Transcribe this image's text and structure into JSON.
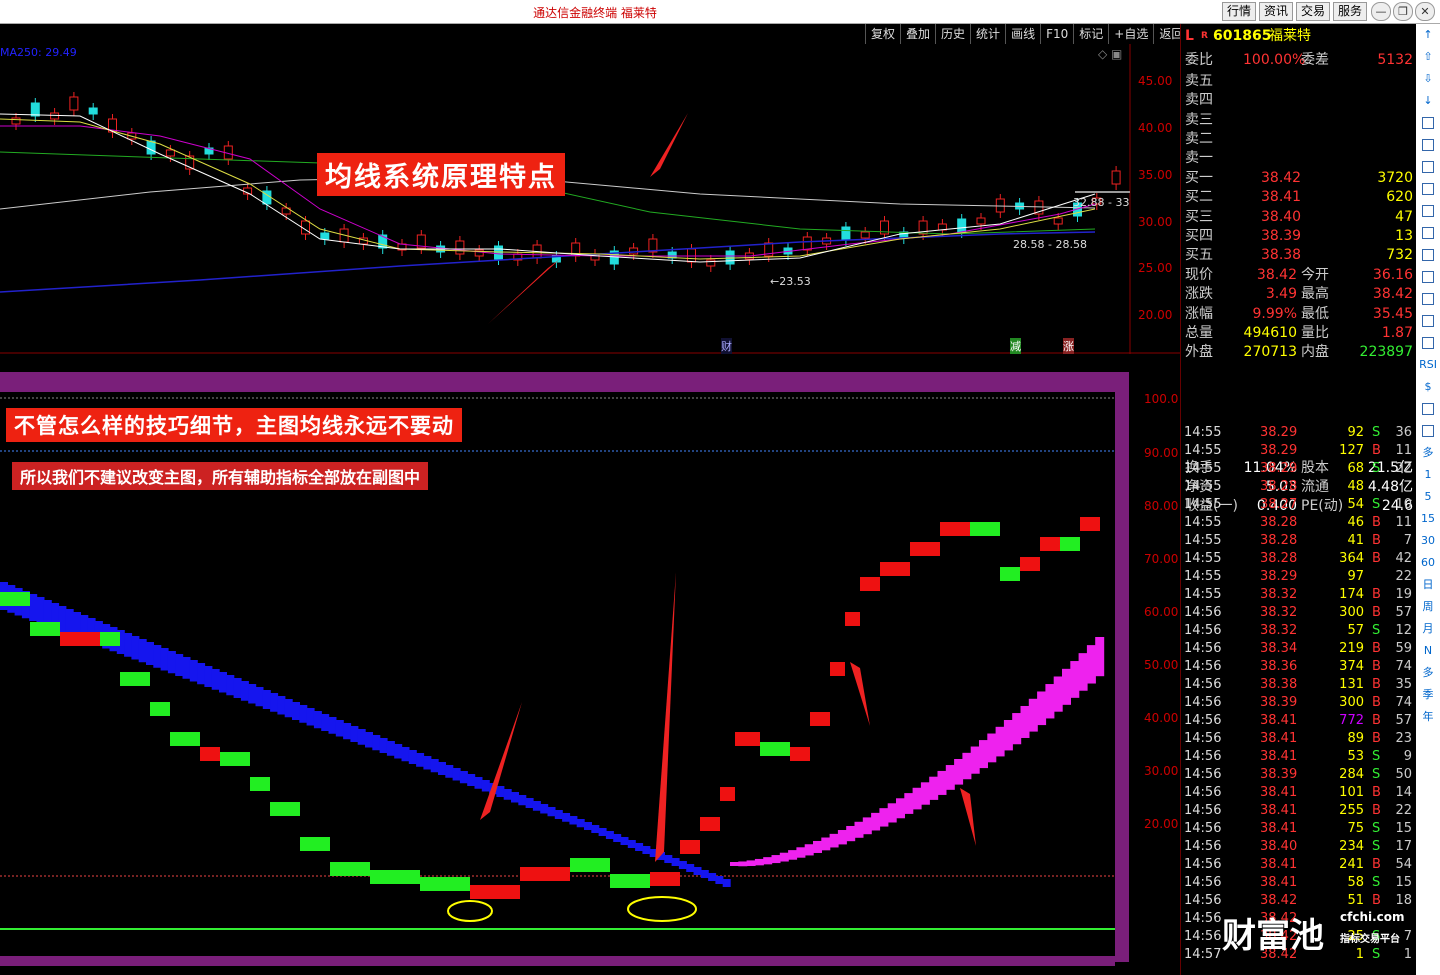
{
  "window": {
    "title": "通达信金融终端  福莱特",
    "buttons": [
      "行情",
      "资讯",
      "交易",
      "服务"
    ]
  },
  "toolbar": [
    "复权",
    "叠加",
    "历史",
    "统计",
    "画线",
    "F10",
    "标记",
    "+自选",
    "返回"
  ],
  "main": {
    "ma_label": "MA250: 29.49",
    "title_banner": "均线系统原理特点",
    "ticks": [
      "45.00",
      "40.00",
      "35.00",
      "30.00",
      "25.00",
      "20.00"
    ],
    "label_low": "23.53",
    "label_high": "32.88 - 33",
    "label_mid": "28.58 - 28.58",
    "markers": [
      "财",
      "减",
      "涨"
    ]
  },
  "sub": {
    "banner1": "不管怎么样的技巧细节，主图均线永远不要动",
    "banner2": "所以我们不建议改变主图，所有辅助指标全部放在副图中",
    "ticks": [
      "100.0",
      "90.00",
      "80.00",
      "70.00",
      "60.00",
      "50.00",
      "40.00",
      "30.00",
      "20.00"
    ]
  },
  "quote": {
    "code": "601865",
    "name": "福莱特",
    "flag_l": "L",
    "flag_r": "R",
    "weibi_label": "委比",
    "weibi": "100.00%",
    "weicha_label": "委差",
    "weicha": "5132",
    "sells": [
      "卖五",
      "卖四",
      "卖三",
      "卖二",
      "卖一"
    ],
    "buys": [
      {
        "l": "买一",
        "p": "38.42",
        "v": "3720"
      },
      {
        "l": "买二",
        "p": "38.41",
        "v": "620"
      },
      {
        "l": "买三",
        "p": "38.40",
        "v": "47"
      },
      {
        "l": "买四",
        "p": "38.39",
        "v": "13"
      },
      {
        "l": "买五",
        "p": "38.38",
        "v": "732"
      }
    ],
    "stats": [
      {
        "l1": "现价",
        "v1": "38.42",
        "l2": "今开",
        "v2": "36.16"
      },
      {
        "l1": "涨跌",
        "v1": "3.49",
        "l2": "最高",
        "v2": "38.42"
      },
      {
        "l1": "涨幅",
        "v1": "9.99%",
        "l2": "最低",
        "v2": "35.45"
      },
      {
        "l1": "总量",
        "v1": "494610",
        "l2": "量比",
        "v2": "1.87"
      },
      {
        "l1": "外盘",
        "v1": "270713",
        "l2": "内盘",
        "v2": "223897"
      },
      {
        "l1": "换手",
        "v1": "11.04%",
        "l2": "股本",
        "v2": "21.5亿"
      },
      {
        "l1": "净资",
        "v1": "5.03",
        "l2": "流通",
        "v2": "4.48亿"
      },
      {
        "l1": "收益(一)",
        "v1": "0.400",
        "l2": "PE(动)",
        "v2": "24.6"
      }
    ]
  },
  "ticks_list": [
    [
      "14:55",
      "38.29",
      "92",
      "S",
      "36"
    ],
    [
      "14:55",
      "38.29",
      "127",
      "B",
      "11"
    ],
    [
      "14:55",
      "38.29",
      "68",
      "S",
      "22"
    ],
    [
      "14:55",
      "38.28",
      "48",
      "",
      ""
    ],
    [
      "14:55",
      "38.27",
      "54",
      "S",
      "10"
    ],
    [
      "14:55",
      "38.28",
      "46",
      "B",
      "11"
    ],
    [
      "14:55",
      "38.28",
      "41",
      "B",
      "7"
    ],
    [
      "14:55",
      "38.28",
      "364",
      "B",
      "42"
    ],
    [
      "14:55",
      "38.29",
      "97",
      "",
      "22"
    ],
    [
      "14:55",
      "38.32",
      "174",
      "B",
      "19"
    ],
    [
      "14:56",
      "38.32",
      "300",
      "B",
      "57"
    ],
    [
      "14:56",
      "38.32",
      "57",
      "S",
      "12"
    ],
    [
      "14:56",
      "38.34",
      "219",
      "B",
      "59"
    ],
    [
      "14:56",
      "38.36",
      "374",
      "B",
      "74"
    ],
    [
      "14:56",
      "38.38",
      "131",
      "B",
      "35"
    ],
    [
      "14:56",
      "38.39",
      "300",
      "B",
      "74"
    ],
    [
      "14:56",
      "38.41",
      "772",
      "B",
      "57"
    ],
    [
      "14:56",
      "38.41",
      "89",
      "B",
      "23"
    ],
    [
      "14:56",
      "38.41",
      "53",
      "S",
      "9"
    ],
    [
      "14:56",
      "38.39",
      "284",
      "S",
      "50"
    ],
    [
      "14:56",
      "38.41",
      "101",
      "B",
      "14"
    ],
    [
      "14:56",
      "38.41",
      "255",
      "B",
      "22"
    ],
    [
      "14:56",
      "38.41",
      "75",
      "S",
      "15"
    ],
    [
      "14:56",
      "38.40",
      "234",
      "S",
      "17"
    ],
    [
      "14:56",
      "38.41",
      "241",
      "B",
      "54"
    ],
    [
      "14:56",
      "38.41",
      "58",
      "S",
      "15"
    ],
    [
      "14:56",
      "38.42",
      "51",
      "B",
      "18"
    ],
    [
      "14:56",
      "38.42",
      "",
      "",
      ""
    ],
    [
      "14:56",
      "38.42",
      "25",
      "S",
      "7"
    ],
    [
      "14:57",
      "38.42",
      "1",
      "S",
      "1"
    ]
  ],
  "iconbar": [
    "↑",
    "⇧",
    "⇩",
    "↓",
    "",
    "",
    "",
    "",
    "",
    "",
    "",
    "",
    "",
    "",
    "",
    "RSI",
    "$",
    "",
    "",
    "多",
    "1",
    "5",
    "15",
    "30",
    "60",
    "日",
    "周",
    "月",
    "N",
    "多",
    "季",
    "年"
  ],
  "logo": {
    "main": "财富池",
    "url": "cfchi.com",
    "sub": "指标交易平台"
  }
}
